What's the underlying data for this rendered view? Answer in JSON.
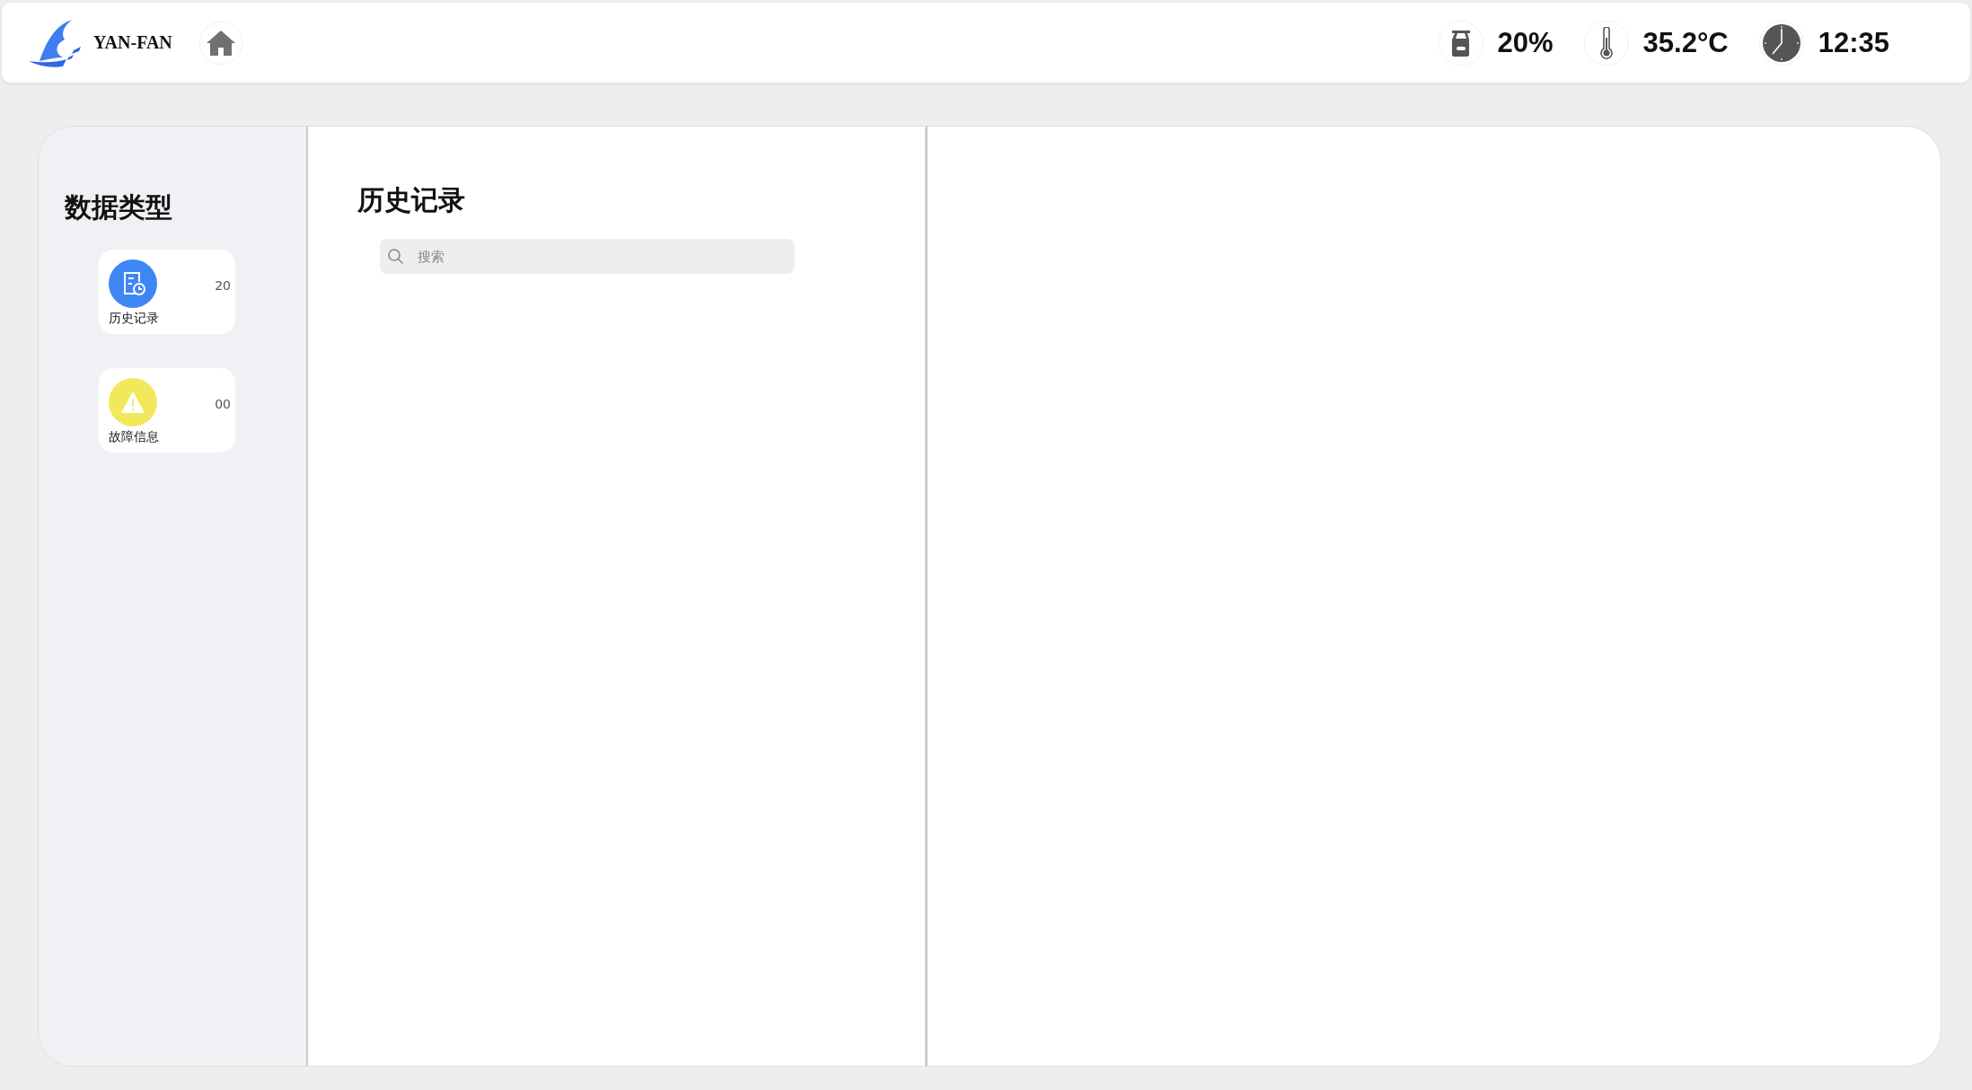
{
  "header": {
    "brand": "YAN-FAN",
    "status": [
      {
        "kind": "tank",
        "value": "20%"
      },
      {
        "kind": "temperature",
        "value": "35.2°C"
      },
      {
        "kind": "clock",
        "value": "12:35"
      }
    ]
  },
  "sidebar": {
    "title": "数据类型",
    "items": [
      {
        "kind": "history",
        "label": "历史记录",
        "count": "20",
        "color": "#3f86f5"
      },
      {
        "kind": "fault",
        "label": "故障信息",
        "count": "00",
        "color": "#f2e85c"
      }
    ]
  },
  "list_panel": {
    "title": "历史记录",
    "search": {
      "placeholder": "搜索"
    }
  }
}
